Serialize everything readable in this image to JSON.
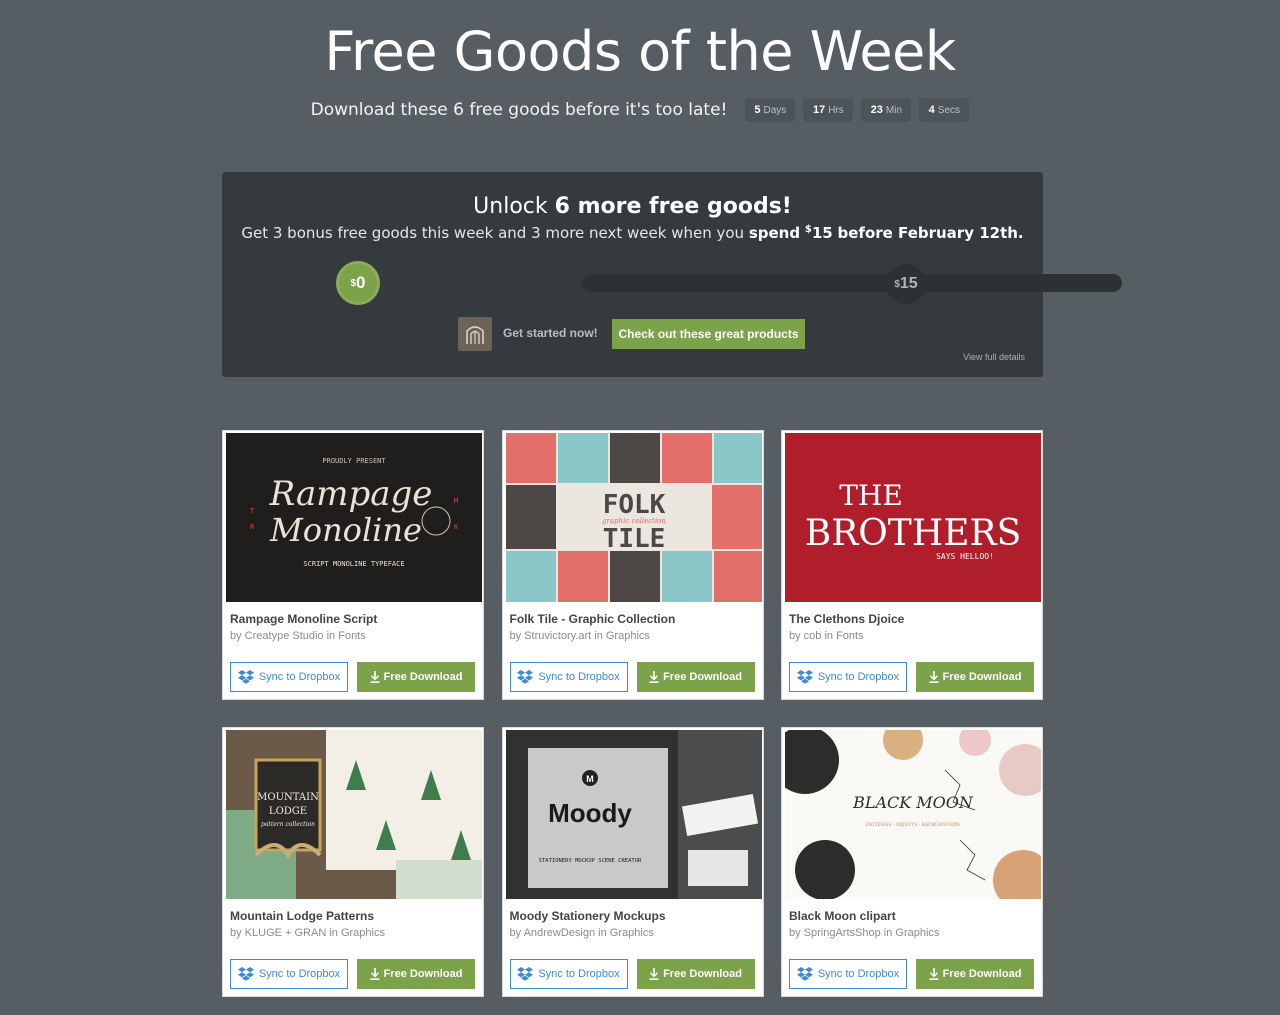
{
  "header": {
    "title": "Free Goods of the Week",
    "subtitle": "Download these 6 free goods before it's too late!",
    "countdown": [
      {
        "value": "5",
        "unit": "Days"
      },
      {
        "value": "17",
        "unit": "Hrs"
      },
      {
        "value": "23",
        "unit": "Min"
      },
      {
        "value": "4",
        "unit": "Secs"
      }
    ]
  },
  "unlock": {
    "heading_prefix": "Unlock",
    "heading_bold": "6 more free goods!",
    "sub_prefix": "Get 3 bonus free goods this week and 3 more next week when you",
    "sub_bold_spend": "spend",
    "sub_amount": "15",
    "sub_bold_suffix": "before February 12th.",
    "currency": "$",
    "progress_start": "0",
    "progress_end": "15",
    "progress_fraction": 0,
    "get_started": "Get started now!",
    "cta_label": "Check out these great products",
    "view_details": "View full details"
  },
  "products": [
    {
      "title": "Rampage Monoline Script",
      "by": "by Creatype Studio in Fonts",
      "sync_label": "Sync to Dropbox",
      "download_label": "Free Download"
    },
    {
      "title": "Folk Tile - Graphic Collection",
      "by": "by Struvictory.art in Graphics",
      "sync_label": "Sync to Dropbox",
      "download_label": "Free Download"
    },
    {
      "title": "The Clethons Djoice",
      "by": "by cob in Fonts",
      "sync_label": "Sync to Dropbox",
      "download_label": "Free Download"
    },
    {
      "title": "Mountain Lodge Patterns",
      "by": "by KLUGE + GRAN in Graphics",
      "sync_label": "Sync to Dropbox",
      "download_label": "Free Download"
    },
    {
      "title": "Moody Stationery Mockups",
      "by": "by AndrewDesign in Graphics",
      "sync_label": "Sync to Dropbox",
      "download_label": "Free Download"
    },
    {
      "title": "Black Moon clipart",
      "by": "by SpringArtsShop in Graphics",
      "sync_label": "Sync to Dropbox",
      "download_label": "Free Download"
    }
  ],
  "thumbs": {
    "rampage": {
      "line1": "Rampage",
      "line2": "Monoline",
      "top": "PROUDLY PRESENT",
      "caption": "SCRIPT MONOLINE TYPEFACE"
    },
    "folk": {
      "line1": "FOLK",
      "line2": "graphic collection",
      "line3": "TILE"
    },
    "brothers": {
      "line1": "THE",
      "line2": "BROTHERS",
      "line3": "SAYS HELLOO!"
    },
    "mountain": {
      "line1": "MOUNTAIN",
      "line2": "LODGE",
      "line3": "pattern collection"
    },
    "moody": {
      "badge": "M",
      "word": "Moody",
      "caption": "STATIONERY MOCKUP SCENE CREATOR"
    },
    "blackmoon": {
      "word": "BLACK MOON",
      "caption": "PATTERNS · OBJECTS · BACKGROUNDS"
    }
  },
  "colors": {
    "background": "#565d63",
    "panel": "#353a3e",
    "accent_green": "#7ca24a",
    "dropbox_blue": "#3d8ad6"
  }
}
